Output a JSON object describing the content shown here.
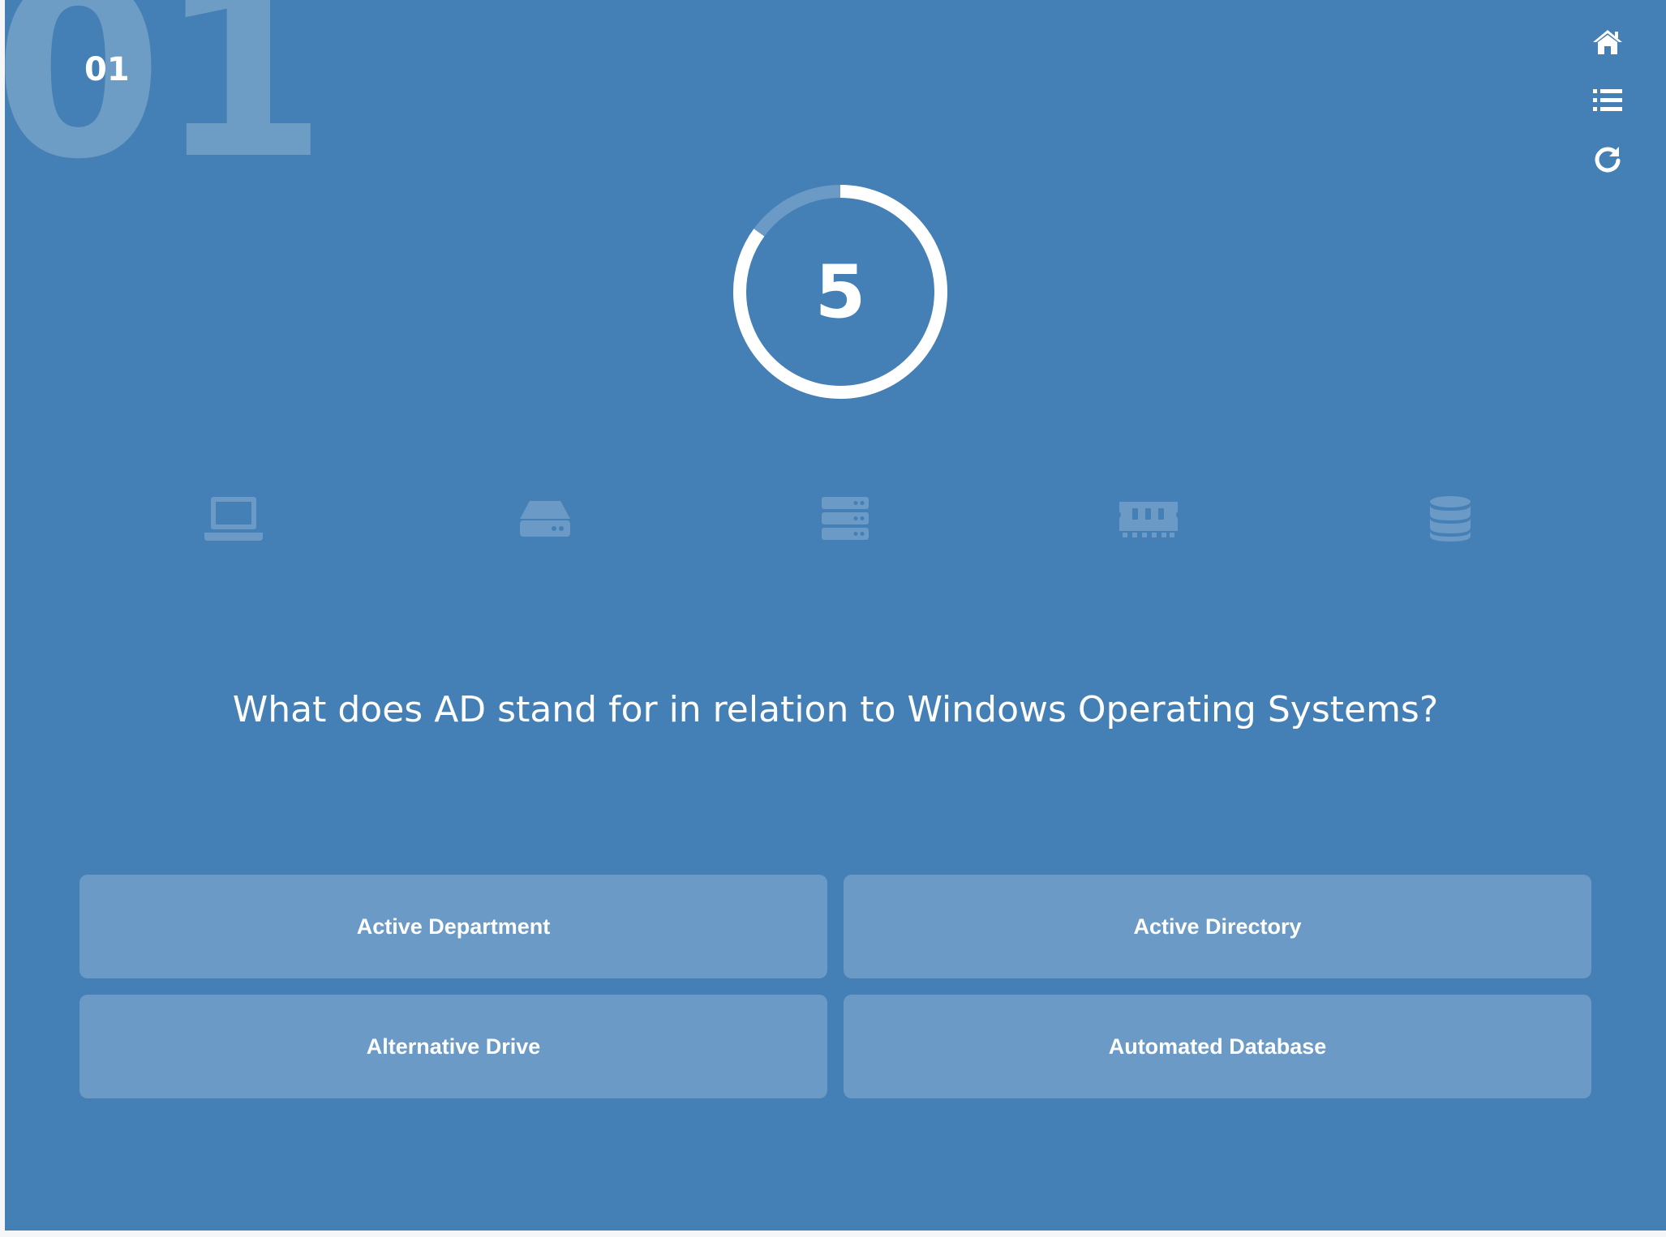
{
  "quiz": {
    "question_number": "01",
    "question_number_background": "01",
    "timer": {
      "value": "5",
      "remaining_fraction": 0.85
    },
    "question": "What does AD stand for in relation to Windows Operating Systems?",
    "answers": [
      {
        "label": "Active Department"
      },
      {
        "label": "Active Directory"
      },
      {
        "label": "Alternative Drive"
      },
      {
        "label": "Automated Database"
      }
    ],
    "category_icons": [
      "laptop-icon",
      "hard-drive-icon",
      "server-icon",
      "memory-icon",
      "database-icon"
    ],
    "toolbar_icons": [
      "home-icon",
      "list-icon",
      "refresh-icon"
    ]
  },
  "colors": {
    "background": "#4480b5",
    "answer_button": "#6a9ac5",
    "icon_faint": "#6a9ac5",
    "text": "#ffffff"
  }
}
